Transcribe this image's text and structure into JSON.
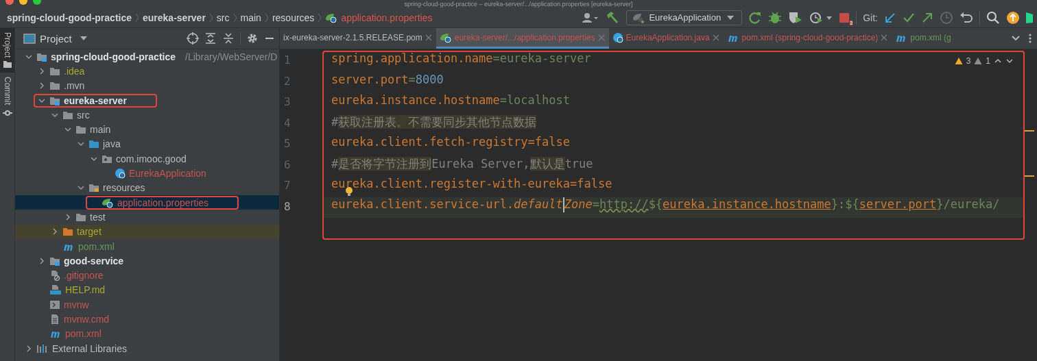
{
  "window": {
    "title": "spring-cloud-good-practice – eureka-server/.../application.properties [eureka-server]"
  },
  "breadcrumbs": [
    {
      "label": "spring-cloud-good-practice",
      "kind": "folder",
      "bold": true
    },
    {
      "label": "eureka-server",
      "kind": "folder",
      "bold": true
    },
    {
      "label": "src",
      "kind": "folder",
      "bold": false
    },
    {
      "label": "main",
      "kind": "folder",
      "bold": false
    },
    {
      "label": "resources",
      "kind": "folder",
      "bold": false
    },
    {
      "label": "application.properties",
      "kind": "file",
      "bold": false
    }
  ],
  "toolbar": {
    "run_config": "EurekaApplication",
    "stop_badge": "3",
    "git_label": "Git:"
  },
  "side_stripe": [
    {
      "label": "Project",
      "selected": true
    },
    {
      "label": "Commit",
      "selected": false
    }
  ],
  "project_panel": {
    "title": "Project",
    "tree": [
      {
        "label": "spring-cloud-good-practice",
        "hint": "/Library/WebServer/D",
        "kind": "module",
        "color": "#dfe1e3",
        "bold": true,
        "expanded": true,
        "selected": false,
        "outlined": false,
        "children": [
          {
            "label": ".idea",
            "kind": "folder",
            "color": "#a8a832",
            "bold": false,
            "expanded": false,
            "selected": false,
            "outlined": false
          },
          {
            "label": ".mvn",
            "kind": "folder",
            "color": "#bbbbbb",
            "bold": false,
            "expanded": false,
            "selected": false,
            "outlined": false
          },
          {
            "label": "eureka-server",
            "kind": "module",
            "color": "#dfe1e3",
            "bold": true,
            "expanded": true,
            "selected": false,
            "outlined": true,
            "children": [
              {
                "label": "src",
                "kind": "folder",
                "color": "#bbbbbb",
                "bold": false,
                "expanded": true,
                "selected": false,
                "outlined": false,
                "children": [
                  {
                    "label": "main",
                    "kind": "folder",
                    "color": "#bbbbbb",
                    "bold": false,
                    "expanded": true,
                    "selected": false,
                    "outlined": false,
                    "children": [
                      {
                        "label": "java",
                        "kind": "source-folder",
                        "color": "#bbbbbb",
                        "bold": false,
                        "expanded": true,
                        "selected": false,
                        "outlined": false,
                        "children": [
                          {
                            "label": "com.imooc.good",
                            "kind": "package",
                            "color": "#bbbbbb",
                            "bold": false,
                            "expanded": true,
                            "selected": false,
                            "outlined": false,
                            "children": [
                              {
                                "label": "EurekaApplication",
                                "kind": "spring-class",
                                "color": "#c75450",
                                "bold": false,
                                "selected": false,
                                "outlined": false
                              }
                            ]
                          }
                        ]
                      },
                      {
                        "label": "resources",
                        "kind": "resources-folder",
                        "color": "#bbbbbb",
                        "bold": false,
                        "expanded": true,
                        "selected": false,
                        "outlined": false,
                        "children": [
                          {
                            "label": "application.properties",
                            "kind": "properties",
                            "color": "#c75450",
                            "bold": false,
                            "selected": true,
                            "outlined": true
                          }
                        ]
                      }
                    ]
                  },
                  {
                    "label": "test",
                    "kind": "folder",
                    "color": "#bbbbbb",
                    "bold": false,
                    "expanded": false,
                    "selected": false,
                    "outlined": false
                  }
                ]
              },
              {
                "label": "target",
                "kind": "excluded-folder",
                "color": "#a8a832",
                "bold": false,
                "expanded": false,
                "selected": false,
                "outlined": false
              },
              {
                "label": "pom.xml",
                "kind": "maven",
                "color": "#629755",
                "bold": false,
                "selected": false,
                "outlined": false
              }
            ]
          },
          {
            "label": "good-service",
            "kind": "module",
            "color": "#dfe1e3",
            "bold": true,
            "expanded": false,
            "selected": false,
            "outlined": false
          },
          {
            "label": ".gitignore",
            "kind": "gitignore",
            "color": "#c75450",
            "bold": false,
            "selected": false,
            "outlined": false
          },
          {
            "label": "HELP.md",
            "kind": "markdown",
            "color": "#a8a832",
            "bold": false,
            "selected": false,
            "outlined": false
          },
          {
            "label": "mvnw",
            "kind": "script",
            "color": "#c75450",
            "bold": false,
            "selected": false,
            "outlined": false
          },
          {
            "label": "mvnw.cmd",
            "kind": "cmd",
            "color": "#c75450",
            "bold": false,
            "selected": false,
            "outlined": false
          },
          {
            "label": "pom.xml",
            "kind": "maven",
            "color": "#c75450",
            "bold": false,
            "selected": false,
            "outlined": false
          }
        ]
      },
      {
        "label": "External Libraries",
        "kind": "libraries",
        "color": "#bbbbbb",
        "bold": false,
        "expanded": false,
        "selected": false,
        "outlined": false
      }
    ]
  },
  "editor_tabs": [
    {
      "label": "ix-eureka-server-2.1.5.RELEASE.pom",
      "kind": "plain",
      "color": "#bbbbbb",
      "selected": false,
      "closable": true
    },
    {
      "label": "eureka-server/.../application.properties",
      "kind": "properties",
      "color": "#c75450",
      "selected": true,
      "closable": true
    },
    {
      "label": "EurekaApplication.java",
      "kind": "spring-class",
      "color": "#c75450",
      "selected": false,
      "closable": true
    },
    {
      "label": "pom.xml (spring-cloud-good-practice)",
      "kind": "maven",
      "color": "#c75450",
      "selected": false,
      "closable": true
    },
    {
      "label": "pom.xml (g",
      "kind": "maven",
      "color": "#629755",
      "selected": false,
      "closable": false
    }
  ],
  "editor": {
    "outlined": true,
    "warnings": "3",
    "weak_warnings": "1",
    "lines": [
      {
        "number": "1",
        "current": false,
        "bulb": false,
        "tokens": [
          {
            "kind": "key",
            "text": "spring.application.name"
          },
          {
            "kind": "value",
            "text": "=eureka-server"
          }
        ]
      },
      {
        "number": "2",
        "current": false,
        "bulb": false,
        "tokens": [
          {
            "kind": "key",
            "text": "server.port"
          },
          {
            "kind": "value",
            "text": "="
          },
          {
            "kind": "number",
            "text": "8000"
          }
        ]
      },
      {
        "number": "3",
        "current": false,
        "bulb": false,
        "tokens": [
          {
            "kind": "key",
            "text": "eureka.instance.hostname"
          },
          {
            "kind": "value",
            "text": "=localhost"
          }
        ]
      },
      {
        "number": "4",
        "current": false,
        "bulb": false,
        "tokens": [
          {
            "kind": "comment",
            "text": "#"
          },
          {
            "kind": "comment-marked",
            "text": "获取注册表。不需要同步其他节点数据"
          }
        ]
      },
      {
        "number": "5",
        "current": false,
        "bulb": false,
        "tokens": [
          {
            "kind": "key",
            "text": "eureka.client.fetch-registry=false"
          }
        ]
      },
      {
        "number": "6",
        "current": false,
        "bulb": false,
        "tokens": [
          {
            "kind": "comment",
            "text": "#"
          },
          {
            "kind": "comment-marked",
            "text": "是否将字节注册到"
          },
          {
            "kind": "comment",
            "text": "Eureka Server,"
          },
          {
            "kind": "comment-marked",
            "text": "默认是"
          },
          {
            "kind": "comment",
            "text": "true"
          }
        ]
      },
      {
        "number": "7",
        "current": false,
        "bulb": true,
        "tokens": [
          {
            "kind": "key",
            "text": "eureka.client.register-with-eureka=false"
          }
        ]
      },
      {
        "number": "8",
        "current": true,
        "bulb": false,
        "tokens": [
          {
            "kind": "key",
            "text": "eureka.client.service-url."
          },
          {
            "kind": "key-italic",
            "text": "default"
          },
          {
            "kind": "key-italic",
            "text": "Zone",
            "caret": true
          },
          {
            "kind": "value",
            "text": "="
          },
          {
            "kind": "url",
            "text": "http://"
          },
          {
            "kind": "value",
            "text": "${"
          },
          {
            "kind": "ref",
            "text": "eureka.instance.hostname"
          },
          {
            "kind": "value",
            "text": "}:${"
          },
          {
            "kind": "ref",
            "text": "server.port"
          },
          {
            "kind": "value",
            "text": "}/eureka/"
          }
        ]
      }
    ]
  }
}
